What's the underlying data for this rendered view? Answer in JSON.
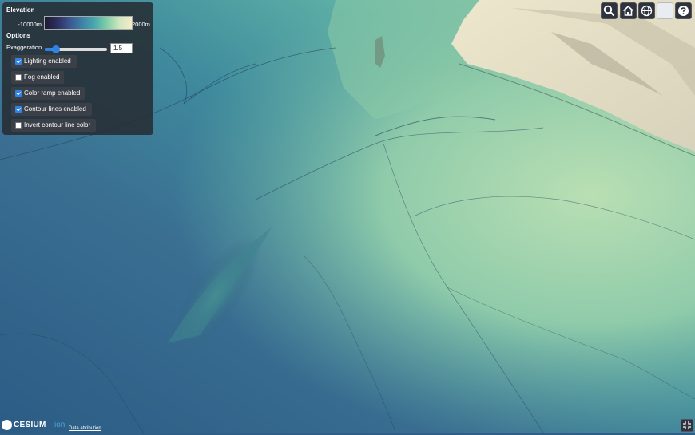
{
  "panel": {
    "elevation_title": "Elevation",
    "legend_min": "-10000m",
    "legend_max": "2000m",
    "options_title": "Options",
    "exaggeration_label": "Exaggeration",
    "exaggeration_value": "1.5",
    "exaggeration_fraction": 0.125,
    "options": [
      {
        "label": "Lighting enabled",
        "checked": true
      },
      {
        "label": "Fog enabled",
        "checked": false
      },
      {
        "label": "Color ramp enabled",
        "checked": true
      },
      {
        "label": "Contour lines enabled",
        "checked": true
      },
      {
        "label": "Invert contour line color",
        "checked": false
      }
    ]
  },
  "toolbar": {
    "buttons": [
      "search-icon",
      "home-icon",
      "globe-icon",
      "blank-icon",
      "help-icon"
    ]
  },
  "branding": {
    "logo_text": "CESIUM",
    "logo_suffix": "ion",
    "attribution": "Data attribution"
  },
  "colors": {
    "accent": "#2f83e3",
    "deep_ocean": "#2f5f86",
    "shelf": "#7fcfa9",
    "land": "#e8e5c9"
  }
}
